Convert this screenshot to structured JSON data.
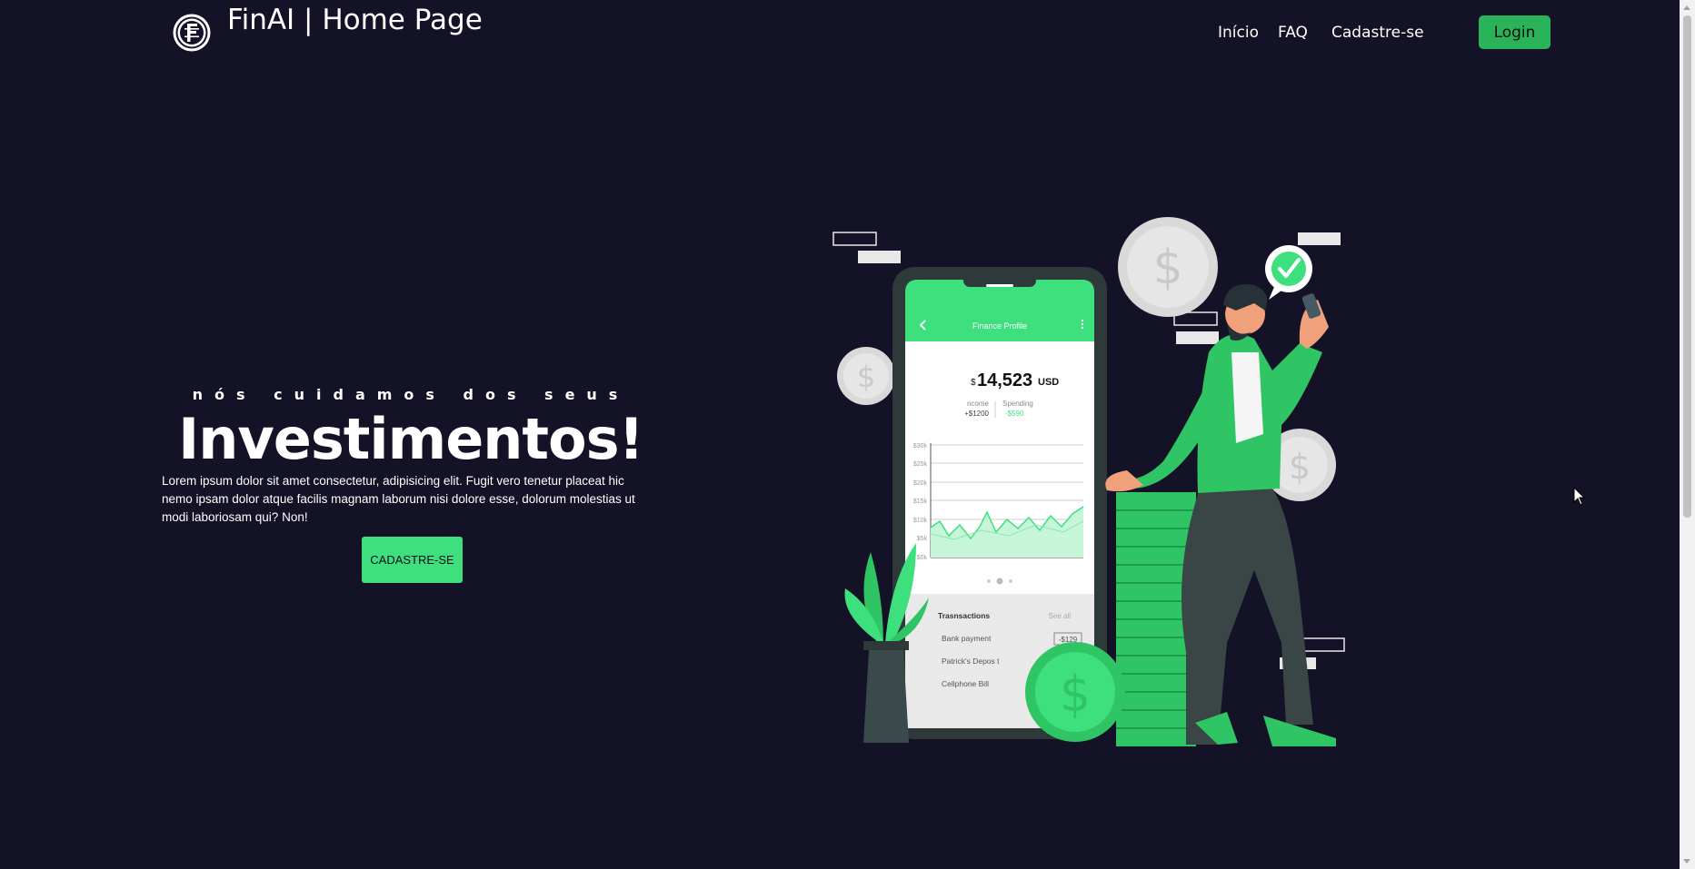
{
  "nav": {
    "brand": "FinAI | Home Page",
    "logo_icon": "coin-f-logo",
    "links": [
      "Início",
      "FAQ",
      "Cadastre-se"
    ],
    "login_label": "Login"
  },
  "hero": {
    "tagline": "nós cuidamos dos seus",
    "headline": "Investimentos!",
    "body": "Lorem ipsum dolor sit amet consectetur, adipisicing elit. Fugit vero tenetur placeat hic nemo ipsam dolor atque facilis magnam laborum nisi dolore esse, dolorum molestias ut modi laboriosam qui? Non!",
    "cta_label": "CADASTRE-SE"
  },
  "phone": {
    "screen_title": "Finance Profile",
    "balance_symbol": "$",
    "balance": "14,523",
    "currency": "USD",
    "income_label": "ncome",
    "income_value": "+$1200",
    "spending_label": "Spending",
    "spending_value": "-$590",
    "y_ticks": [
      "$30k",
      "$25k",
      "$20k",
      "$15k",
      "$10k",
      "$5k",
      "$0k"
    ],
    "transactions_label": "Trasnsactions",
    "see_all": "See all",
    "transactions": [
      {
        "name": "Bank payment",
        "amount": "-$129"
      },
      {
        "name": "Patrick's Depos t",
        "amount": ""
      },
      {
        "name": "Cellphone Bill",
        "amount": ""
      }
    ]
  },
  "colors": {
    "background": "#131226",
    "accent": "#3ee07e",
    "login": "#2bb35a"
  }
}
